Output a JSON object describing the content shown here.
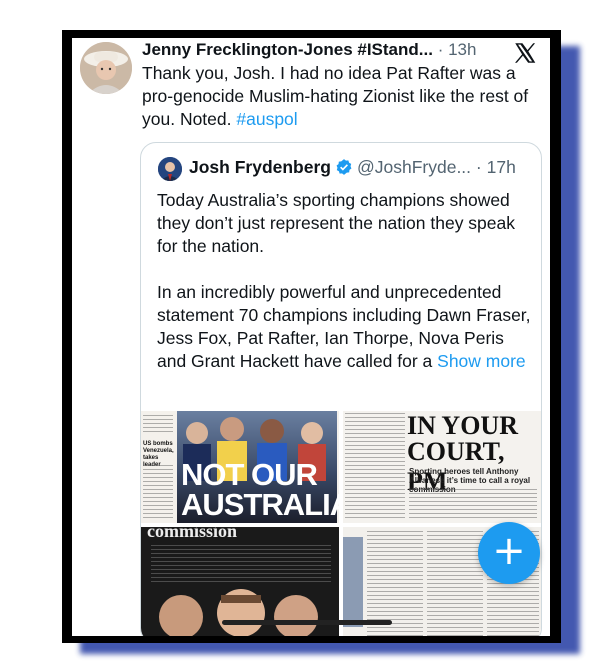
{
  "tweet": {
    "author_name": "Jenny Frecklington-Jones #IStand...",
    "time": "· 13h",
    "text": "Thank you, Josh. I had no idea Pat Rafter was a pro-genocide Muslim-hating Zionist like the rest of you. Noted. ",
    "hashtag": "#auspol",
    "close_icon": "x-logo-icon"
  },
  "quoted": {
    "author_name": "Josh Frydenberg",
    "handle": "@JoshFryde...",
    "time": "· 17h",
    "paragraph1": "Today Australia’s sporting champions showed they don’t just represent the nation they speak for the nation.",
    "paragraph2": "In an incredibly powerful and unprecedented statement 70 champions including Dawn Fraser, Jess Fox, Pat Rafter, Ian Thorpe, Nova Peris and Grant Hackett have called for a ",
    "show_more": "Show more",
    "verified_icon": "verified-badge-icon"
  },
  "media": {
    "front1_headline_line1": "NOT OUR",
    "front1_headline_line2": "AUSTRALIA",
    "front1_side": "US bombs Venezuela, takes leader",
    "front2_headline_line1": "IN YOUR",
    "front2_headline_line2": "COURT, PM",
    "front2_subhead": "Sporting heroes tell Anthony Albanese it’s time to call a royal commission",
    "page3_heading": "commission"
  },
  "fab": {
    "label": "+",
    "color": "#1d9bf0"
  },
  "colors": {
    "frame": "#000000",
    "shadow": "#2f46a8",
    "link": "#1d9bf0"
  }
}
